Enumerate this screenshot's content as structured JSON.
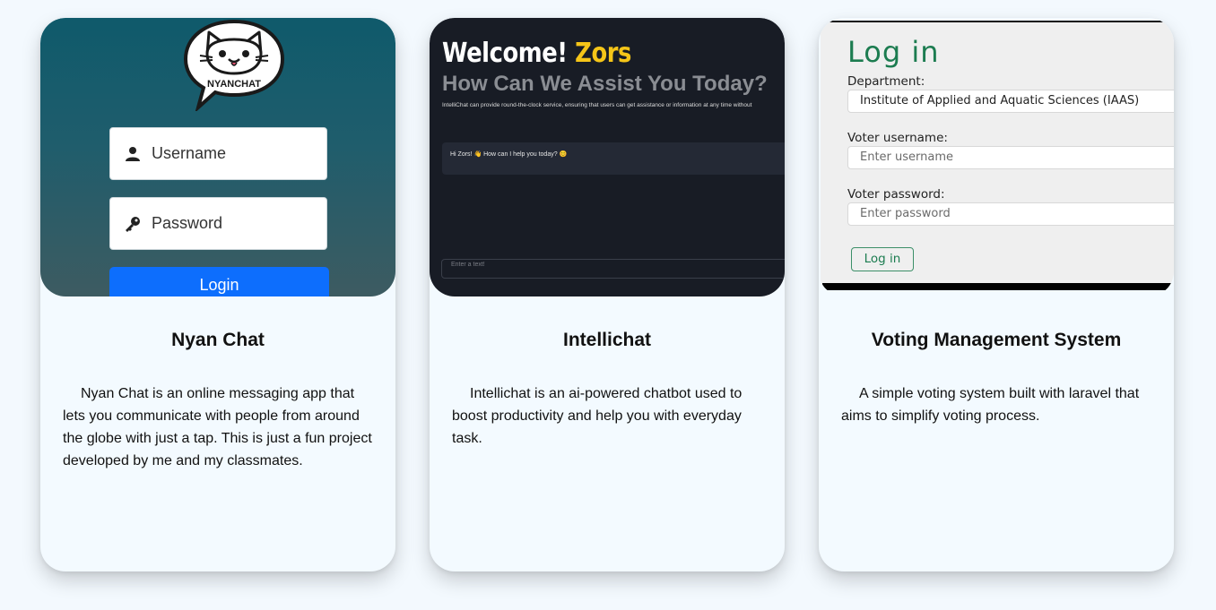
{
  "projects": [
    {
      "title": "Nyan Chat",
      "description": "Nyan Chat is an online messaging app that lets you communicate with people from around the globe with just a tap. This is just a fun project developed by me and my classmates.",
      "preview": {
        "logo_text": "NYANCHAT",
        "username_placeholder": "Username",
        "password_placeholder": "Password",
        "login_label": "Login",
        "colors": {
          "bg_top": "#0f5a6b",
          "bg_bottom": "#3d5b61",
          "button": "#0d6efd"
        }
      }
    },
    {
      "title": "Intellichat",
      "description": "Intellichat is an ai-powered chatbot used to boost productivity and help you with everyday task.",
      "preview": {
        "welcome": "Welcome!",
        "user_name": "Zors",
        "subtitle": "How Can We Assist You Today?",
        "info": "IntelliChat can provide round-the-clock service, ensuring that users can get assistance or information at any time without",
        "bot_message": "Hi Zors! 👋 How can I help you today? 😊",
        "input_placeholder": "Enter a text!",
        "colors": {
          "bg": "#181c25",
          "accent": "#f5c518"
        }
      }
    },
    {
      "title": "Voting Management System",
      "description": "A simple voting system built with laravel that aims to simplify voting process.",
      "preview": {
        "heading": "Log in",
        "department_label": "Department:",
        "department_value": "Institute of Applied and Aquatic Sciences (IAAS)",
        "username_label": "Voter username:",
        "username_placeholder": "Enter username",
        "password_label": "Voter password:",
        "password_placeholder": "Enter password",
        "login_label": "Log in",
        "colors": {
          "accent": "#1c7c50"
        }
      }
    }
  ]
}
